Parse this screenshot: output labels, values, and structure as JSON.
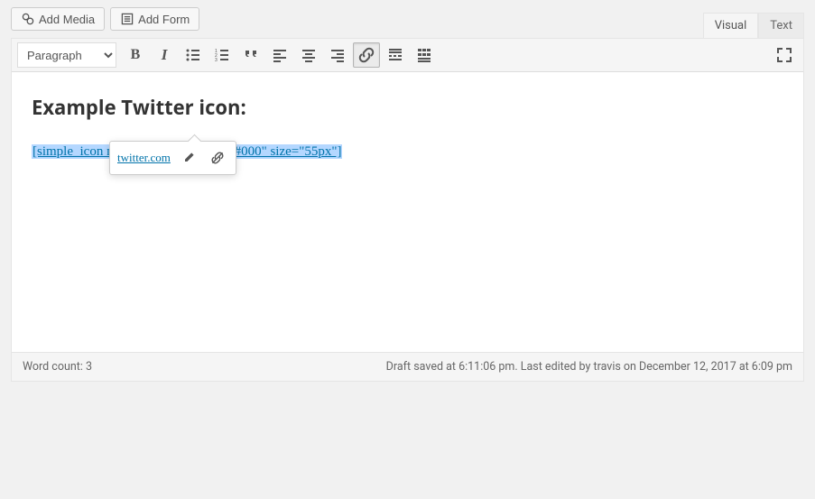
{
  "media_buttons": {
    "add_media": "Add Media",
    "add_form": "Add Form"
  },
  "tabs": {
    "visual": "Visual",
    "text": "Text",
    "active": "visual"
  },
  "toolbar": {
    "format_label": "Paragraph",
    "buttons": {
      "bold": "B",
      "italic": "I"
    }
  },
  "content": {
    "heading": "Example Twitter icon:",
    "shortcode": "[simple_icon name=\"twitter\" color=\"#000\" size=\"55px\"]"
  },
  "link_popover": {
    "url": "twitter.com"
  },
  "status": {
    "word_count_label": "Word count: 3",
    "save_info": "Draft saved at 6:11:06 pm. Last edited by travis on December 12, 2017 at 6:09 pm"
  }
}
